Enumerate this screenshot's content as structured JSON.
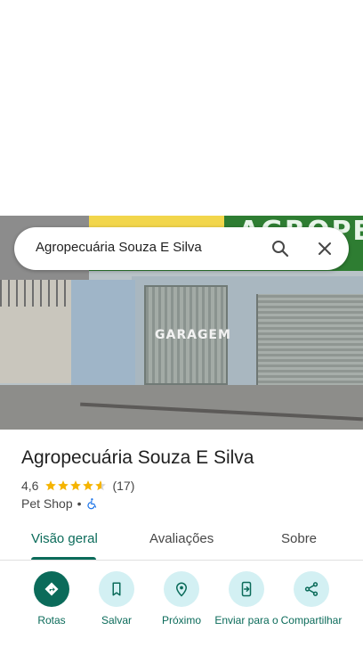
{
  "search": {
    "query": "Agropecuária Souza E Silva"
  },
  "photo": {
    "sign_text": "AGROPEC",
    "door_text": "GARAGEM"
  },
  "place": {
    "title": "Agropecuária Souza E Silva",
    "rating": "4,6",
    "rating_value": 4.6,
    "reviews_count": "(17)",
    "category": "Pet Shop",
    "separator": "•"
  },
  "tabs": [
    {
      "label": "Visão geral",
      "active": true
    },
    {
      "label": "Avaliações",
      "active": false
    },
    {
      "label": "Sobre",
      "active": false
    }
  ],
  "actions": [
    {
      "label": "Rotas",
      "icon": "directions-icon"
    },
    {
      "label": "Salvar",
      "icon": "bookmark-icon"
    },
    {
      "label": "Próximo",
      "icon": "nearby-icon"
    },
    {
      "label": "Enviar para o",
      "icon": "send-to-phone-icon"
    },
    {
      "label": "Compartilhar",
      "icon": "share-icon"
    }
  ],
  "colors": {
    "accent": "#0b6b5a",
    "action_bg": "#d3f0f3",
    "star": "#f5b400"
  }
}
